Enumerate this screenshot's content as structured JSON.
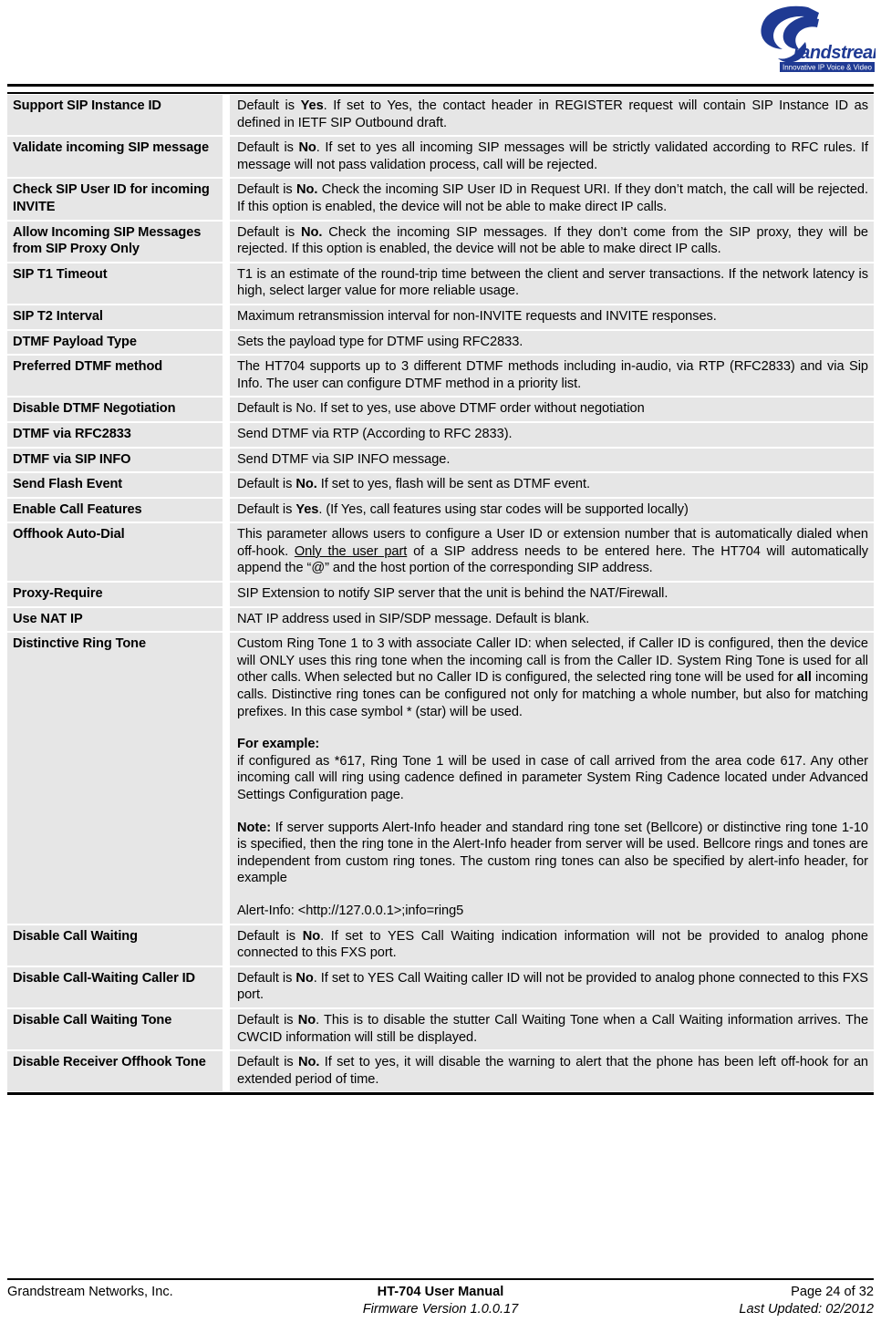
{
  "header": {
    "logo_name": "Grandstream",
    "logo_wordmark": "randstream",
    "logo_tagline": "Innovative IP Voice & Video",
    "logo_color": "#1F3A93"
  },
  "table": {
    "rows": [
      {
        "param": "Support SIP Instance ID",
        "desc": [
          {
            "parts": [
              {
                "t": "Default is "
              },
              {
                "t": "Yes",
                "style": "b"
              },
              {
                "t": ". If set to Yes, the contact header in REGISTER request will contain SIP Instance ID as defined in IETF SIP Outbound draft."
              }
            ]
          }
        ]
      },
      {
        "param": "Validate incoming SIP message",
        "desc": [
          {
            "parts": [
              {
                "t": "Default is "
              },
              {
                "t": "No",
                "style": "b"
              },
              {
                "t": ". If set to yes all incoming SIP messages will be strictly validated according to RFC rules. If message will not pass validation process, call will be rejected."
              }
            ]
          }
        ]
      },
      {
        "param": "Check SIP User ID for incoming INVITE",
        "desc": [
          {
            "parts": [
              {
                "t": "Default is "
              },
              {
                "t": "No.",
                "style": "b"
              },
              {
                "t": " Check the incoming SIP User ID in Request URI. If they don’t match, the call will be rejected. If this option is enabled, the device will not be able to make direct IP calls."
              }
            ]
          }
        ]
      },
      {
        "param": "Allow Incoming SIP Messages from SIP Proxy Only",
        "desc": [
          {
            "parts": [
              {
                "t": "Default is "
              },
              {
                "t": "No.",
                "style": "b"
              },
              {
                "t": " Check the incoming SIP messages. If they don’t come from the SIP proxy, they will be rejected. If this option is enabled, the device will not be able to make direct IP calls."
              }
            ]
          }
        ]
      },
      {
        "param": "SIP T1 Timeout",
        "desc": [
          {
            "parts": [
              {
                "t": "T1 is an estimate of the round-trip time between the client and server transactions. If the network latency is high, select larger value for more reliable usage."
              }
            ]
          }
        ]
      },
      {
        "param": "SIP T2 Interval",
        "desc": [
          {
            "parts": [
              {
                "t": "Maximum retransmission interval for non-INVITE requests and INVITE responses."
              }
            ]
          }
        ]
      },
      {
        "param": "DTMF Payload Type",
        "desc": [
          {
            "parts": [
              {
                "t": "Sets the payload type for DTMF using RFC2833."
              }
            ]
          }
        ]
      },
      {
        "param": "Preferred DTMF method",
        "desc": [
          {
            "parts": [
              {
                "t": "The HT704 supports up to 3 different DTMF methods including in-audio, via RTP (RFC2833) and via Sip Info.  The user can configure DTMF method in a priority list."
              }
            ]
          }
        ]
      },
      {
        "param": "Disable DTMF Negotiation",
        "desc": [
          {
            "nojustify": true,
            "parts": [
              {
                "t": "Default is No. If set to yes, use above DTMF order without negotiation"
              }
            ]
          }
        ]
      },
      {
        "param": "DTMF via RFC2833",
        "desc": [
          {
            "nojustify": true,
            "parts": [
              {
                "t": "Send DTMF via RTP (According to RFC 2833)."
              }
            ]
          }
        ]
      },
      {
        "param": "DTMF via SIP INFO",
        "desc": [
          {
            "nojustify": true,
            "parts": [
              {
                "t": "Send DTMF via SIP INFO message."
              }
            ]
          }
        ]
      },
      {
        "param": "Send Flash Event",
        "desc": [
          {
            "nojustify": true,
            "parts": [
              {
                "t": "Default is "
              },
              {
                "t": "No.",
                "style": "b"
              },
              {
                "t": "  If set to yes, flash will be sent as DTMF event."
              }
            ]
          }
        ]
      },
      {
        "param": "Enable Call Features",
        "desc": [
          {
            "nojustify": true,
            "parts": [
              {
                "t": "Default is "
              },
              {
                "t": "Yes",
                "style": "b"
              },
              {
                "t": ". (If Yes, call features using star codes will be supported locally)"
              }
            ]
          }
        ]
      },
      {
        "param": "Offhook Auto-Dial",
        "desc": [
          {
            "parts": [
              {
                "t": "This parameter allows users to configure a User ID or extension number that is automatically dialed when off-hook. "
              },
              {
                "t": "Only the user part",
                "style": "u"
              },
              {
                "t": " of a SIP address needs to be entered here. The HT704 will automatically append the “@” and the host portion of the corresponding SIP address."
              }
            ]
          }
        ]
      },
      {
        "param": "Proxy-Require",
        "desc": [
          {
            "nojustify": true,
            "parts": [
              {
                "t": "SIP Extension to notify SIP server that the unit is behind the NAT/Firewall."
              }
            ]
          }
        ]
      },
      {
        "param": "Use NAT IP",
        "desc": [
          {
            "nojustify": true,
            "parts": [
              {
                "t": "NAT IP address used in SIP/SDP message. Default is blank."
              }
            ]
          }
        ]
      },
      {
        "param": "Distinctive Ring Tone",
        "desc": [
          {
            "parts": [
              {
                "t": "Custom Ring Tone 1 to 3 with associate Caller ID: when selected, if Caller ID is configured, then the device will ONLY uses this ring tone when the incoming call is from the Caller ID.  System Ring Tone is used for all other calls. When selected but no Caller ID is configured, the selected ring tone will be used for "
              },
              {
                "t": "all",
                "style": "b"
              },
              {
                "t": " incoming calls. Distinctive ring tones can be configured not only for matching a whole number, but also for matching prefixes. In this case symbol * (star) will be used."
              }
            ]
          },
          {
            "gap": true,
            "nojustify": true,
            "parts": [
              {
                "t": "For example:",
                "style": "b"
              }
            ]
          },
          {
            "parts": [
              {
                "t": " if configured as *617, Ring Tone 1 will be used in case of call arrived from the area code 617. Any other incoming call will ring using cadence defined in parameter System Ring Cadence located under Advanced Settings Configuration page."
              }
            ]
          },
          {
            "gap": true,
            "parts": [
              {
                "t": "Note:",
                "style": "b"
              },
              {
                "t": " If server supports Alert-Info header and standard ring tone set (Bellcore) or distinctive ring tone 1-10 is specified, then the ring tone in the Alert-Info header from server will be used. Bellcore rings and tones are independent from custom ring tones. The custom ring tones can also be specified by alert-info header, for example"
              }
            ]
          },
          {
            "gap": true,
            "nojustify": true,
            "parts": [
              {
                "t": "Alert-Info: <http://127.0.0.1>;info=ring5"
              }
            ]
          }
        ]
      },
      {
        "param": "Disable Call Waiting",
        "desc": [
          {
            "parts": [
              {
                "t": "Default is "
              },
              {
                "t": "No",
                "style": "b"
              },
              {
                "t": ". If set to YES Call Waiting indication information will not be provided to analog phone connected to this FXS port."
              }
            ]
          }
        ]
      },
      {
        "param": "Disable Call-Waiting Caller ID",
        "desc": [
          {
            "parts": [
              {
                "t": "Default is "
              },
              {
                "t": "No",
                "style": "b"
              },
              {
                "t": ". If set to YES Call Waiting caller ID will not be provided to analog phone connected to this FXS port."
              }
            ]
          }
        ]
      },
      {
        "param": "Disable Call Waiting Tone",
        "desc": [
          {
            "parts": [
              {
                "t": "Default is "
              },
              {
                "t": "No",
                "style": "b"
              },
              {
                "t": ". This is to disable the stutter Call Waiting Tone when a Call Waiting information arrives. The CWCID information will still be displayed."
              }
            ]
          }
        ]
      },
      {
        "param": "Disable Receiver Offhook Tone",
        "desc": [
          {
            "parts": [
              {
                "t": "Default is "
              },
              {
                "t": "No.",
                "style": "b"
              },
              {
                "t": " If set to yes, it will disable the warning to alert that the phone has been left off-hook for an extended period of time."
              }
            ]
          }
        ]
      }
    ]
  },
  "footer": {
    "company": "Grandstream Networks, Inc.",
    "manual_title": "HT-704 User Manual",
    "firmware": "Firmware Version 1.0.0.17",
    "page": "Page 24 of 32",
    "updated": "Last Updated: 02/2012"
  }
}
